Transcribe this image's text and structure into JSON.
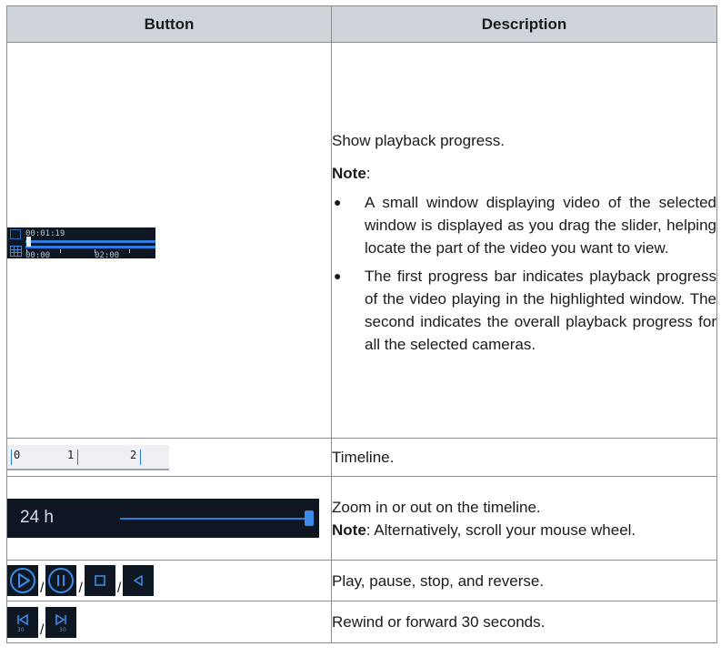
{
  "table": {
    "headers": {
      "button": "Button",
      "description": "Description"
    },
    "progress_row": {
      "widget": {
        "current_time": "00:01:19",
        "tick_labels": [
          "00:00",
          "02:00"
        ],
        "icons": [
          "single-window-grid-icon",
          "multi-window-grid-icon"
        ]
      },
      "text": "Show playback progress.",
      "note_label": "Note",
      "note_colon": ":",
      "bullets": [
        "A small window displaying video of the selected window is displayed as you drag the slider, helping locate the part of the video you want to view.",
        "The first progress bar indicates playback progress of the video playing in the highlighted window. The second indicates the overall playback progress for all the selected cameras."
      ]
    },
    "timeline_row": {
      "ruler_labels": [
        "0",
        "1",
        "2"
      ],
      "text": "Timeline."
    },
    "zoom_row": {
      "range_label": "24 h",
      "text": "Zoom in or out on the timeline.",
      "note_label": "Note",
      "note_text": ": Alternatively, scroll your mouse wheel.",
      "slider_level": 1.0
    },
    "playback_row": {
      "separator": "/",
      "icons": [
        "play-icon",
        "pause-icon",
        "stop-icon",
        "reverse-icon"
      ],
      "text": "Play, pause, stop, and reverse."
    },
    "rewind_row": {
      "separator": "/",
      "icons": [
        "rewind-30-icon",
        "forward-30-icon"
      ],
      "icon_label": "30",
      "text": "Rewind or forward 30 seconds."
    }
  },
  "colors": {
    "header_bg": "#cfd4da",
    "accent": "#2f7de0",
    "widget_bg": "#0f1722"
  }
}
